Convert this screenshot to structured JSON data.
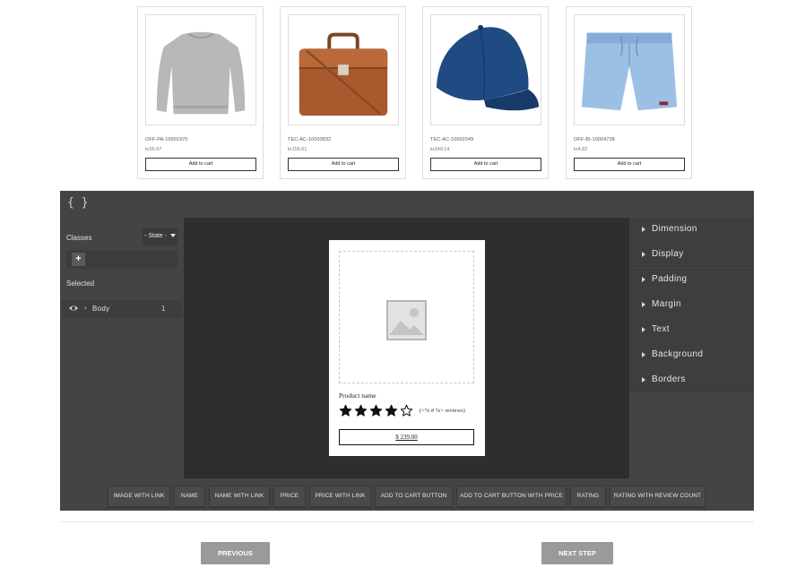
{
  "products": [
    {
      "sku": "OFF-PA-10001970",
      "price": "kr26.67",
      "button_label": "Add to cart",
      "image": "grey-sweater"
    },
    {
      "sku": "TEC-AC-10003832",
      "price": "kr155.51",
      "button_label": "Add to cart",
      "image": "brown-briefcase"
    },
    {
      "sku": "TEC-AC-10002049",
      "price": "kr249.14",
      "button_label": "Add to cart",
      "image": "blue-cap"
    },
    {
      "sku": "OFF-BI-10004728",
      "price": "kr4.82",
      "button_label": "Add to cart",
      "image": "blue-shorts"
    }
  ],
  "editor": {
    "code_icon": "{ }",
    "classes_label": "Classes",
    "state_select": "- State -",
    "add_class_label": "+",
    "selected_label": "Selected",
    "layer": {
      "name": "Body",
      "count": "1"
    },
    "preview": {
      "product_name": "Product name",
      "rating": 4,
      "rating_max": 5,
      "reviews_text": "(<% # %> reviews)",
      "price": "$ 239.00"
    },
    "style_sectors": [
      "Dimension",
      "Display",
      "Padding",
      "Margin",
      "Text",
      "Background",
      "Borders"
    ],
    "blocks": [
      "IMAGE WITH LINK",
      "NAME",
      "NAME WITH LINK",
      "PRICE",
      "PRICE WITH LINK",
      "ADD TO CART BUTTON",
      "ADD TO CART BUTTON WITH PRICE",
      "RATING",
      "RATING WITH REVIEW COUNT"
    ]
  },
  "navigation": {
    "previous_label": "PREVIOUS",
    "next_label": "NEXT STEP"
  },
  "colors": {
    "editor_bg": "#444444",
    "canvas_bg": "#2e2e2e",
    "nav_button": "#9a9a9a"
  }
}
